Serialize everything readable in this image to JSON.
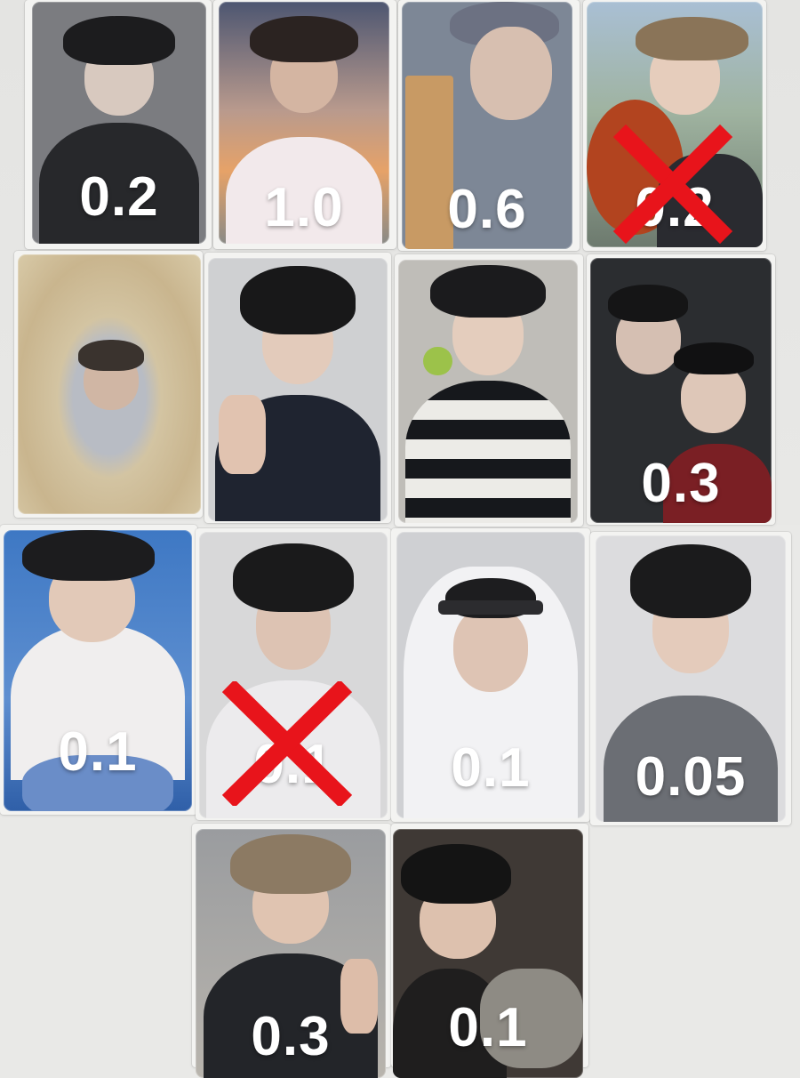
{
  "cards": [
    {
      "id": "r1c1",
      "price": "0.2",
      "sold": false
    },
    {
      "id": "r1c2",
      "price": "1.0",
      "sold": false
    },
    {
      "id": "r1c3",
      "price": "0.6",
      "sold": false
    },
    {
      "id": "r1c4",
      "price": "0.2",
      "sold": true
    },
    {
      "id": "r2c1",
      "price": "",
      "sold": false
    },
    {
      "id": "r2c2",
      "price": "",
      "sold": false
    },
    {
      "id": "r2c3",
      "price": "",
      "sold": false
    },
    {
      "id": "r2c4",
      "price": "0.3",
      "sold": false
    },
    {
      "id": "r3c1",
      "price": "0.1",
      "sold": false
    },
    {
      "id": "r3c2",
      "price": "0.1",
      "sold": true
    },
    {
      "id": "r3c3",
      "price": "0.1",
      "sold": false
    },
    {
      "id": "r3c4",
      "price": "0.05",
      "sold": false
    },
    {
      "id": "r4c1",
      "price": "0.3",
      "sold": false
    },
    {
      "id": "r4c2",
      "price": "0.1",
      "sold": false
    }
  ],
  "colors": {
    "price_text": "#ffffff",
    "sold_mark": "#e8141b",
    "background": "#e9e9e7"
  }
}
